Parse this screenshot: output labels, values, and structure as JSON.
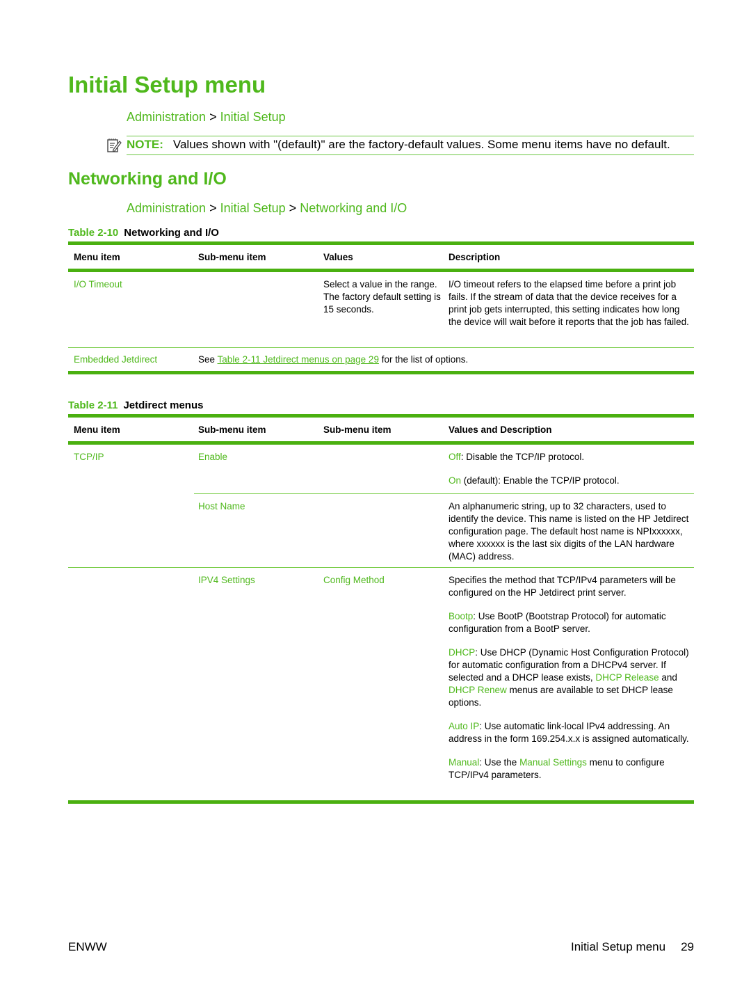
{
  "page": {
    "title": "Initial Setup menu",
    "breadcrumb1": [
      "Administration",
      "Initial Setup"
    ],
    "breadcrumb_separator": ">",
    "note": {
      "icon": "note-pencil-icon",
      "label": "NOTE:",
      "text": "Values shown with \"(default)\" are the factory-default values. Some menu items have no default."
    },
    "section_title": "Networking and I/O",
    "breadcrumb2": [
      "Administration",
      "Initial Setup",
      "Networking and I/O"
    ]
  },
  "table1": {
    "number": "Table 2-10",
    "title": "Networking and I/O",
    "headers": [
      "Menu item",
      "Sub-menu item",
      "Values",
      "Description"
    ],
    "rows": [
      {
        "menu_item": "I/O Timeout",
        "sub_menu_item": "",
        "values": "Select a value in the range. The factory default setting is 15 seconds.",
        "description": "I/O timeout refers to the elapsed time before a print job fails. If the stream of data that the device receives for a print job gets interrupted, this setting indicates how long the device will wait before it reports that the job has failed."
      },
      {
        "menu_item": "Embedded Jetdirect",
        "see_prefix": "See",
        "see_link": "Table 2-11 Jetdirect menus on page 29",
        "see_suffix": "for the list of options."
      }
    ]
  },
  "table2": {
    "number": "Table 2-11",
    "title": "Jetdirect menus",
    "headers": [
      "Menu item",
      "Sub-menu item",
      "Sub-menu item",
      "Values and Description"
    ],
    "rows": [
      {
        "menu_item": "TCP/IP",
        "sub_menu_item": "Enable",
        "sub_sub_menu_item": "",
        "entries": [
          {
            "key": "Off",
            "text": ": Disable the TCP/IP protocol."
          },
          {
            "key": "On",
            "text": " (default): Enable the TCP/IP protocol."
          }
        ]
      },
      {
        "menu_item": "",
        "sub_menu_item": "Host Name",
        "sub_sub_menu_item": "",
        "description": "An alphanumeric string, up to 32 characters, used to identify the device. This name is listed on the HP Jetdirect configuration page. The default host name is NPIxxxxxx, where xxxxxx is the last six digits of the LAN hardware (MAC) address."
      },
      {
        "menu_item": "",
        "sub_menu_item": "IPV4 Settings",
        "sub_sub_menu_item": "Config Method",
        "intro": "Specifies the method that TCP/IPv4 parameters will be configured on the HP Jetdirect print server.",
        "bootp": {
          "key": "Bootp",
          "text": ": Use BootP (Bootstrap Protocol) for automatic configuration from a BootP server."
        },
        "dhcp": {
          "key": "DHCP",
          "text1": ": Use DHCP (Dynamic Host Configuration Protocol) for automatic configuration from a DHCPv4 server. If selected and a DHCP lease exists, ",
          "link1": "DHCP Release",
          "text2": " and ",
          "link2": "DHCP Renew",
          "text3": " menus are available to set DHCP lease options."
        },
        "autoip": {
          "key": "Auto IP",
          "text": ": Use automatic link-local IPv4 addressing. An address in the form 169.254.x.x is assigned automatically."
        },
        "manual": {
          "key": "Manual",
          "text1": ": Use the ",
          "link": "Manual Settings",
          "text2": " menu to configure TCP/IPv4 parameters."
        }
      }
    ]
  },
  "footer": {
    "left": "ENWW",
    "section": "Initial Setup menu",
    "page_number": "29"
  },
  "colors": {
    "accent_green": "#4fb81c",
    "rule_green": "#4ab010",
    "text": "#000000"
  }
}
